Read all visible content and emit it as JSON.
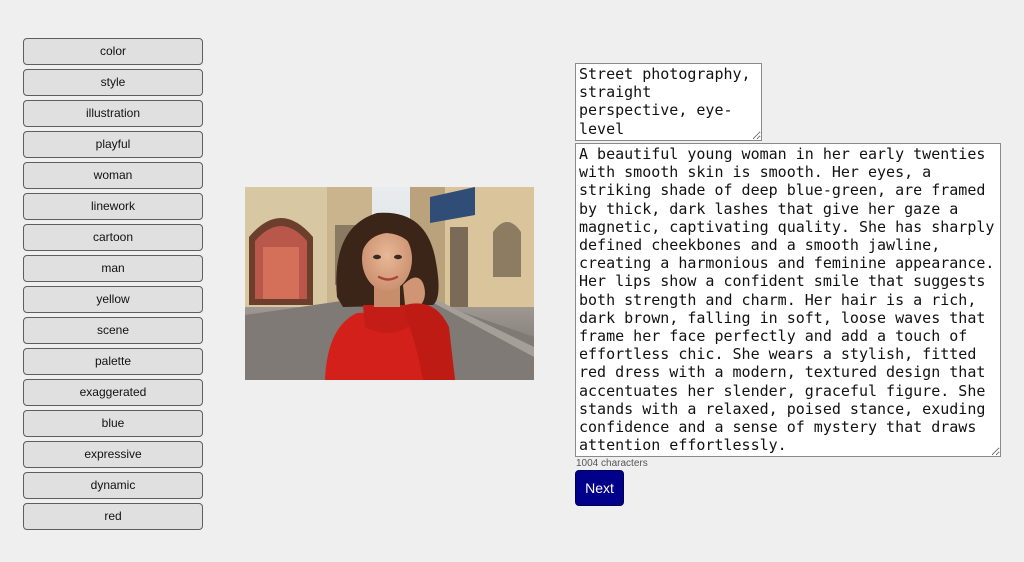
{
  "tags": [
    "color",
    "style",
    "illustration",
    "playful",
    "woman",
    "linework",
    "cartoon",
    "man",
    "yellow",
    "scene",
    "palette",
    "exaggerated",
    "blue",
    "expressive",
    "dynamic",
    "red"
  ],
  "image": {
    "alt": "young woman in a red turtleneck on a street"
  },
  "style_text": "Street photography, straight perspective, eye-level",
  "description_text": "A beautiful young woman in her early twenties with smooth skin is smooth. Her eyes, a striking shade of deep blue-green, are framed by thick, dark lashes that give her gaze a magnetic, captivating quality. She has sharply defined cheekbones and a smooth jawline, creating a harmonious and feminine appearance. Her lips show a confident smile that suggests both strength and charm. Her hair is a rich, dark brown, falling in soft, loose waves that frame her face perfectly and add a touch of effortless chic. She wears a stylish, fitted red dress with a modern, textured design that accentuates her slender, graceful figure. She stands with a relaxed, poised stance, exuding confidence and a sense of mystery that draws attention effortlessly.",
  "char_count_text": "1004 characters",
  "next_label": "Next",
  "colors": {
    "background": "#efefef",
    "tag_button_bg": "#e0e0e0",
    "next_button_bg": "#00008b"
  }
}
